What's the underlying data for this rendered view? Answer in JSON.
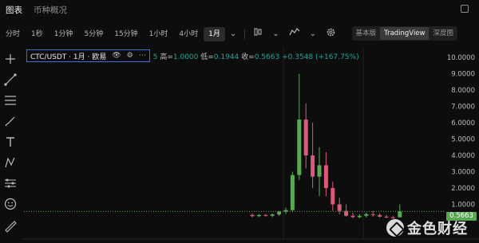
{
  "tabs": [
    {
      "label": "图表",
      "active": true
    },
    {
      "label": "币种概况",
      "active": false
    }
  ],
  "toolbar": {
    "timeframes": [
      "分时",
      "1秒",
      "1分钟",
      "5分钟",
      "15分钟",
      "1小时",
      "4小时",
      "1月"
    ],
    "active_timeframe": "1月",
    "views": [
      "基本版",
      "TradingView",
      "深度图"
    ],
    "active_view": "TradingView"
  },
  "legend": {
    "symbol": "CTC/USDT · 1月 · 欧易",
    "open_suffix": "5",
    "high_label": "高=",
    "high": "1.0000",
    "low_label": "低=",
    "low": "0.1944",
    "close_label": "收=",
    "close": "0.5663",
    "change": "+0.3548 (+167.75%)"
  },
  "price_axis": {
    "ticks": [
      "10.0000",
      "9.0000",
      "8.0000",
      "7.0000",
      "6.0000",
      "5.0000",
      "4.0000",
      "3.0000",
      "2.0000",
      "1.0000"
    ],
    "current_price": "0.5663"
  },
  "watermark": {
    "text": "金色财经"
  },
  "colors": {
    "up": "#5aa854",
    "down": "#d95a7a",
    "background": "#0d0d0d",
    "accent_border": "#3b6fd8"
  },
  "chart_data": {
    "type": "candlestick",
    "ylim": [
      0,
      10.5
    ],
    "candles": [
      {
        "o": 0.35,
        "h": 0.45,
        "l": 0.2,
        "c": 0.28
      },
      {
        "o": 0.28,
        "h": 0.4,
        "l": 0.22,
        "c": 0.35
      },
      {
        "o": 0.35,
        "h": 0.42,
        "l": 0.25,
        "c": 0.3
      },
      {
        "o": 0.3,
        "h": 0.45,
        "l": 0.22,
        "c": 0.38
      },
      {
        "o": 0.38,
        "h": 0.6,
        "l": 0.3,
        "c": 0.55
      },
      {
        "o": 0.55,
        "h": 0.8,
        "l": 0.4,
        "c": 0.65
      },
      {
        "o": 0.65,
        "h": 3.0,
        "l": 0.55,
        "c": 2.8
      },
      {
        "o": 2.8,
        "h": 9.0,
        "l": 2.5,
        "c": 6.2
      },
      {
        "o": 6.2,
        "h": 7.2,
        "l": 3.2,
        "c": 4.0
      },
      {
        "o": 4.0,
        "h": 6.0,
        "l": 2.0,
        "c": 2.7
      },
      {
        "o": 2.7,
        "h": 4.5,
        "l": 1.5,
        "c": 3.4
      },
      {
        "o": 3.4,
        "h": 4.2,
        "l": 1.5,
        "c": 2.0
      },
      {
        "o": 2.0,
        "h": 2.4,
        "l": 0.6,
        "c": 1.0
      },
      {
        "o": 1.0,
        "h": 1.4,
        "l": 0.4,
        "c": 0.6
      },
      {
        "o": 0.6,
        "h": 1.0,
        "l": 0.25,
        "c": 0.3
      },
      {
        "o": 0.3,
        "h": 0.5,
        "l": 0.15,
        "c": 0.22
      },
      {
        "o": 0.22,
        "h": 0.4,
        "l": 0.15,
        "c": 0.3
      },
      {
        "o": 0.3,
        "h": 0.5,
        "l": 0.2,
        "c": 0.4
      },
      {
        "o": 0.4,
        "h": 0.6,
        "l": 0.25,
        "c": 0.35
      },
      {
        "o": 0.35,
        "h": 0.45,
        "l": 0.2,
        "c": 0.25
      },
      {
        "o": 0.25,
        "h": 0.35,
        "l": 0.15,
        "c": 0.2
      },
      {
        "o": 0.2,
        "h": 0.3,
        "l": 0.12,
        "c": 0.18
      },
      {
        "o": 0.21,
        "h": 1.0,
        "l": 0.19,
        "c": 0.57
      }
    ]
  }
}
